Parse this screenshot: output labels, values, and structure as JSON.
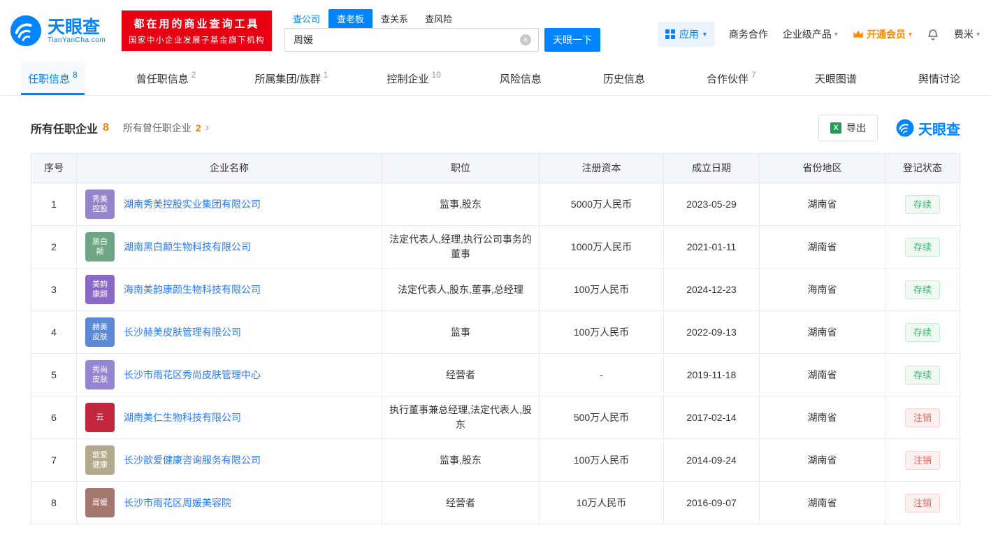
{
  "header": {
    "logo": {
      "title": "天眼查",
      "subtitle": "TianYanCha.com"
    },
    "banner": {
      "line1": "都在用的商业查询工具",
      "line2": "国家中小企业发展子基金旗下机构"
    },
    "search": {
      "tabs": [
        "查公司",
        "查老板",
        "查关系",
        "查风险"
      ],
      "value": "周媛",
      "clear": "×",
      "button": "天眼一下"
    },
    "nav": {
      "apps": "应用",
      "cooperation": "商务合作",
      "enterprise": "企业级产品",
      "vip": "开通会员",
      "username": "费米",
      "caret": "▾"
    }
  },
  "tabs": [
    {
      "label": "任职信息",
      "count": "8"
    },
    {
      "label": "曾任职信息",
      "count": "2"
    },
    {
      "label": "所属集团/族群",
      "count": "1"
    },
    {
      "label": "控制企业",
      "count": "10"
    },
    {
      "label": "风险信息",
      "count": ""
    },
    {
      "label": "历史信息",
      "count": ""
    },
    {
      "label": "合作伙伴",
      "count": "7"
    },
    {
      "label": "天眼图谱",
      "count": ""
    },
    {
      "label": "舆情讨论",
      "count": ""
    }
  ],
  "section": {
    "title": "所有任职企业",
    "title_count": "8",
    "subtitle": "所有曾任职企业",
    "subtitle_count": "2",
    "chevron": "›",
    "export_icon": "X",
    "export_label": "导出",
    "brand": "天眼查"
  },
  "table": {
    "columns": [
      "序号",
      "企业名称",
      "职位",
      "注册资本",
      "成立日期",
      "省份地区",
      "登记状态"
    ],
    "status_colors": {
      "active": "#3cb873",
      "revoked": "#ec615c"
    },
    "rows": [
      {
        "no": "1",
        "icon_text": "秀美控股",
        "icon_bg": "#9583cb",
        "company": "湖南秀美控股实业集团有限公司",
        "position": "监事,股东",
        "capital": "5000万人民币",
        "date": "2023-05-29",
        "region": "湖南省",
        "status": "存续",
        "status_type": "active"
      },
      {
        "no": "2",
        "icon_text": "黑白颠",
        "icon_bg": "#6fa584",
        "company": "湖南黑白颠生物科技有限公司",
        "position": "法定代表人,经理,执行公司事务的董事",
        "capital": "1000万人民币",
        "date": "2021-01-11",
        "region": "湖南省",
        "status": "存续",
        "status_type": "active"
      },
      {
        "no": "3",
        "icon_text": "美韵康颜",
        "icon_bg": "#8a68c8",
        "company": "海南美韵康颜生物科技有限公司",
        "position": "法定代表人,股东,董事,总经理",
        "capital": "100万人民币",
        "date": "2024-12-23",
        "region": "海南省",
        "status": "存续",
        "status_type": "active"
      },
      {
        "no": "4",
        "icon_text": "赫美皮肤",
        "icon_bg": "#5c88d5",
        "company": "长沙赫美皮肤管理有限公司",
        "position": "监事",
        "capital": "100万人民币",
        "date": "2022-09-13",
        "region": "湖南省",
        "status": "存续",
        "status_type": "active"
      },
      {
        "no": "5",
        "icon_text": "秀尚皮肤",
        "icon_bg": "#9486d2",
        "company": "长沙市雨花区秀尚皮肤管理中心",
        "position": "经营者",
        "capital": "-",
        "date": "2019-11-18",
        "region": "湖南省",
        "status": "存续",
        "status_type": "active"
      },
      {
        "no": "6",
        "icon_text": "云",
        "icon_bg": "#c3263f",
        "company": "湖南美仁生物科技有限公司",
        "position": "执行董事兼总经理,法定代表人,股东",
        "capital": "500万人民币",
        "date": "2017-02-14",
        "region": "湖南省",
        "status": "注销",
        "status_type": "revoked"
      },
      {
        "no": "7",
        "icon_text": "歆爱健康",
        "icon_bg": "#b3a98d",
        "company": "长沙歆爱健康咨询服务有限公司",
        "position": "监事,股东",
        "capital": "100万人民币",
        "date": "2014-09-24",
        "region": "湖南省",
        "status": "注销",
        "status_type": "revoked"
      },
      {
        "no": "8",
        "icon_text": "周媛",
        "icon_bg": "#a4766d",
        "company": "长沙市雨花区周媛美容院",
        "position": "经营者",
        "capital": "10万人民币",
        "date": "2016-09-07",
        "region": "湖南省",
        "status": "注销",
        "status_type": "revoked"
      }
    ]
  }
}
